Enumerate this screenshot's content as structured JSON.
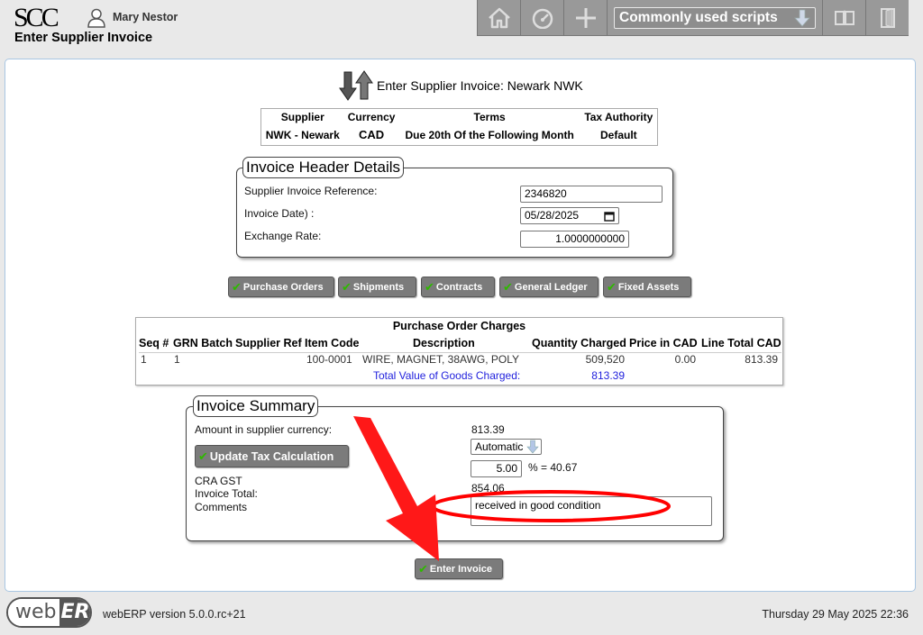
{
  "header": {
    "logo": "SCC",
    "user_name": "Mary Nestor",
    "page_title": "Enter Supplier Invoice",
    "scripts_label": "Commonly used scripts"
  },
  "invoice_title": "Enter Supplier Invoice: Newark NWK",
  "supplier_table": {
    "headers": [
      "Supplier",
      "Currency",
      "Terms",
      "Tax Authority"
    ],
    "row": [
      "NWK - Newark",
      "CAD",
      "Due 20th Of the Following Month",
      "Default"
    ]
  },
  "header_details": {
    "legend": "Invoice Header Details",
    "ref_label": "Supplier Invoice Reference:",
    "ref_value": "2346820",
    "date_label": "Invoice Date) :",
    "date_value": "05/28/2025",
    "rate_label": "Exchange Rate:",
    "rate_value": "1.0000000000"
  },
  "buttons": {
    "purchase_orders": "Purchase Orders",
    "shipments": "Shipments",
    "contracts": "Contracts",
    "general_ledger": "General Ledger",
    "fixed_assets": "Fixed Assets",
    "update_tax": "Update Tax Calculation",
    "enter_invoice": "Enter Invoice"
  },
  "po_charges": {
    "caption": "Purchase Order Charges",
    "headers": [
      "Seq #",
      "GRN Batch",
      "Supplier Ref",
      "Item Code",
      "Description",
      "Quantity Charged",
      "Price in CAD",
      "Line Total CAD"
    ],
    "row": {
      "seq": "1",
      "grn_batch": "1",
      "supplier_ref": "",
      "item_code": "100-0001",
      "description": "WIRE, MAGNET, 38AWG, POLY",
      "quantity": "509,520",
      "price": "0.00",
      "line_total": "813.39"
    },
    "total_label": "Total Value of Goods Charged:",
    "total_value": "813.39"
  },
  "summary": {
    "legend": "Invoice Summary",
    "amount_label": "Amount in supplier currency:",
    "amount_value": "813.39",
    "tax_mode": "Automatic",
    "gst_label": "CRA GST",
    "tax_rate": "5.00",
    "tax_calc": "% = 40.67",
    "total_label": "Invoice Total:",
    "total_value": "854.06",
    "comments_label": "Comments",
    "comments_value": "received in good condition"
  },
  "footer": {
    "logo_a": "web",
    "logo_b": "ERP",
    "version": "webERP version 5.0.0.rc+21",
    "datetime": "Thursday 29 May 2025 22:36"
  },
  "colors": {
    "annotation": "#ff0000",
    "check": "#2fb800",
    "link_blue": "#2222dd",
    "button_gray": "#7b7b7b"
  },
  "icons": [
    "user-icon",
    "home-icon",
    "dashboard-icon",
    "plus-icon",
    "arrow-down-icon",
    "manual-icon",
    "logout-icon",
    "swap-arrows-icon",
    "checkmark-icon",
    "calendar-icon"
  ]
}
